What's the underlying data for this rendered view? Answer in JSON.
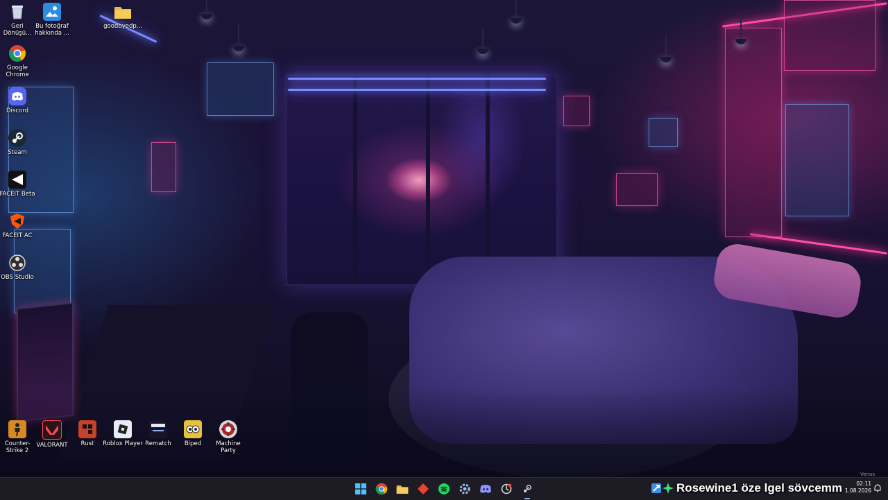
{
  "desktop": {
    "icons": [
      {
        "label": "Geri Dönüşü...",
        "icon": "recycle-bin-icon"
      },
      {
        "label": "Bu fotoğraf hakkında ...",
        "icon": "photo-info-icon"
      },
      {
        "label": "goodbyedp...",
        "icon": "folder-icon"
      },
      {
        "label": "Google Chrome",
        "icon": "chrome-icon"
      },
      {
        "label": "Discord",
        "icon": "discord-icon"
      },
      {
        "label": "Steam",
        "icon": "steam-icon"
      },
      {
        "label": "FACEIT Beta",
        "icon": "faceit-icon"
      },
      {
        "label": "FACEIT AC",
        "icon": "faceit-ac-icon"
      },
      {
        "label": "OBS Studio",
        "icon": "obs-icon"
      },
      {
        "label": "Counter-Strike 2",
        "icon": "cs2-icon"
      },
      {
        "label": "VALORANT",
        "icon": "valorant-icon"
      },
      {
        "label": "Rust",
        "icon": "rust-icon"
      },
      {
        "label": "Roblox Player",
        "icon": "roblox-icon"
      },
      {
        "label": "Rematch",
        "icon": "rematch-icon"
      },
      {
        "label": "Biped",
        "icon": "biped-icon"
      },
      {
        "label": "Machine Party",
        "icon": "machine-party-icon"
      }
    ],
    "corner_label": "Venus"
  },
  "taskbar": {
    "apps": [
      "start",
      "chrome",
      "file-explorer",
      "app-red",
      "spotify",
      "app-settings-gear",
      "discord",
      "app-circle",
      "steam"
    ],
    "overlay_text": "Rosewine1 öze lgel sövcemm",
    "time": "02:11",
    "date": "1.08.2026"
  },
  "colors": {
    "taskbar_bg": "#1d1c24",
    "neon_blue": "#7a8cff",
    "neon_pink": "#ff4fa8"
  }
}
